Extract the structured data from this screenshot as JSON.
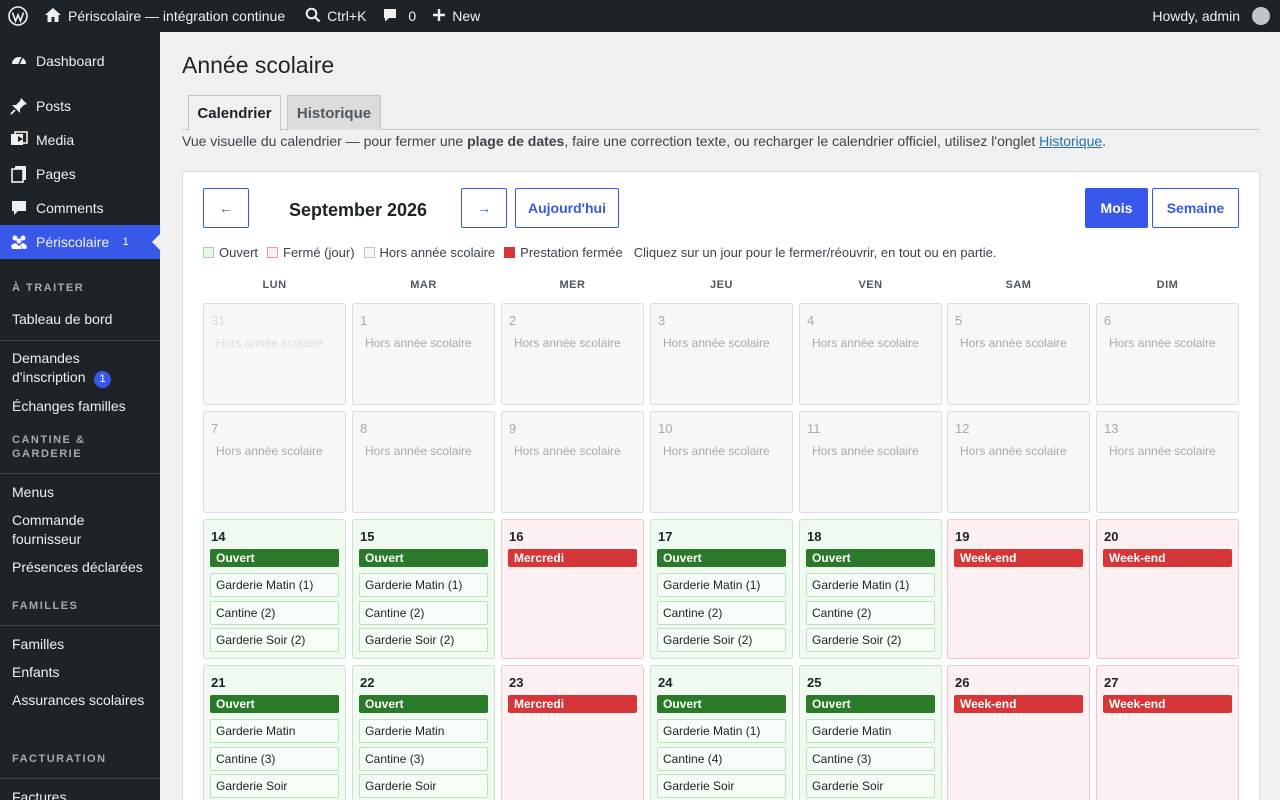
{
  "adminbar": {
    "site_name": "Périscolaire — intégration continue",
    "search_shortcut": "Ctrl+K",
    "comments_count": "0",
    "new_label": "New",
    "howdy": "Howdy, admin"
  },
  "sidebar": {
    "top_items": [
      {
        "label": "Dashboard",
        "icon": "dashboard-icon"
      },
      {
        "label": "Posts",
        "icon": "pin-icon"
      },
      {
        "label": "Media",
        "icon": "media-icon"
      },
      {
        "label": "Pages",
        "icon": "pages-icon"
      },
      {
        "label": "Comments",
        "icon": "comment-icon"
      }
    ],
    "active": {
      "label": "Périscolaire",
      "badge": "1",
      "icon": "group-icon"
    },
    "sections": [
      {
        "heading": "À TRAITER",
        "items": [
          "Tableau de bord"
        ]
      },
      {
        "heading": "",
        "items": [
          "Demandes d'inscription",
          "Échanges familles"
        ],
        "badge": "1"
      },
      {
        "heading": "CANTINE & GARDERIE",
        "items": [
          "Menus",
          "Commande fournisseur",
          "Présences déclarées"
        ]
      },
      {
        "heading": "FAMILLES",
        "items": [
          "Familles",
          "Enfants",
          "Assurances scolaires"
        ]
      },
      {
        "heading": "FACTURATION",
        "items": [
          "Factures"
        ]
      }
    ]
  },
  "page": {
    "title": "Année scolaire",
    "tabs": [
      "Calendrier",
      "Historique"
    ],
    "intro_pre": "Vue visuelle du calendrier — pour fermer une ",
    "intro_bold": "plage de dates",
    "intro_mid": ", faire une correction texte, ou recharger le calendrier officiel, utilisez l'onglet ",
    "intro_link": "Historique",
    "intro_post": "."
  },
  "calendar": {
    "prev": "←",
    "next": "→",
    "month": "September 2026",
    "today": "Aujourd'hui",
    "view_month": "Mois",
    "view_week": "Semaine",
    "legend": [
      {
        "label": "Ouvert",
        "color": "#eaf6ea",
        "border": "#a6d5a6"
      },
      {
        "label": "Fermé (jour)",
        "color": "#fcf0f0",
        "border": "#e89c9c"
      },
      {
        "label": "Hors année scolaire",
        "color": "#f6f7f7",
        "border": "#c3c4c7"
      },
      {
        "label": "Prestation fermée",
        "color": "#d63638",
        "border": "#d63638"
      }
    ],
    "hint": "Cliquez sur un jour pour le fermer/réouvrir, en tout ou en partie.",
    "weekdays": [
      "LUN",
      "MAR",
      "MER",
      "JEU",
      "VEN",
      "SAM",
      "DIM"
    ],
    "weeks": [
      [
        {
          "day": "31",
          "type": "hors",
          "label": "Hors année scolaire",
          "dim": true
        },
        {
          "day": "1",
          "type": "hors",
          "label": "Hors année scolaire"
        },
        {
          "day": "2",
          "type": "hors",
          "label": "Hors année scolaire"
        },
        {
          "day": "3",
          "type": "hors",
          "label": "Hors année scolaire"
        },
        {
          "day": "4",
          "type": "hors",
          "label": "Hors année scolaire"
        },
        {
          "day": "5",
          "type": "hors",
          "label": "Hors année scolaire"
        },
        {
          "day": "6",
          "type": "hors",
          "label": "Hors année scolaire"
        }
      ],
      [
        {
          "day": "7",
          "type": "hors",
          "label": "Hors année scolaire"
        },
        {
          "day": "8",
          "type": "hors",
          "label": "Hors année scolaire"
        },
        {
          "day": "9",
          "type": "hors",
          "label": "Hors année scolaire"
        },
        {
          "day": "10",
          "type": "hors",
          "label": "Hors année scolaire"
        },
        {
          "day": "11",
          "type": "hors",
          "label": "Hors année scolaire"
        },
        {
          "day": "12",
          "type": "hors",
          "label": "Hors année scolaire"
        },
        {
          "day": "13",
          "type": "hors",
          "label": "Hors année scolaire"
        }
      ],
      [
        {
          "day": "14",
          "type": "open",
          "label": "Ouvert",
          "services": [
            "Garderie Matin (1)",
            "Cantine (2)",
            "Garderie Soir (2)"
          ]
        },
        {
          "day": "15",
          "type": "open",
          "label": "Ouvert",
          "services": [
            "Garderie Matin (1)",
            "Cantine (2)",
            "Garderie Soir (2)"
          ]
        },
        {
          "day": "16",
          "type": "closed",
          "label": "Mercredi"
        },
        {
          "day": "17",
          "type": "open",
          "label": "Ouvert",
          "services": [
            "Garderie Matin (1)",
            "Cantine (2)",
            "Garderie Soir (2)"
          ]
        },
        {
          "day": "18",
          "type": "open",
          "label": "Ouvert",
          "services": [
            "Garderie Matin (1)",
            "Cantine (2)",
            "Garderie Soir (2)"
          ]
        },
        {
          "day": "19",
          "type": "closed",
          "label": "Week-end"
        },
        {
          "day": "20",
          "type": "closed",
          "label": "Week-end"
        }
      ],
      [
        {
          "day": "21",
          "type": "open",
          "label": "Ouvert",
          "services": [
            "Garderie Matin",
            "Cantine (3)",
            "Garderie Soir"
          ]
        },
        {
          "day": "22",
          "type": "open",
          "label": "Ouvert",
          "services": [
            "Garderie Matin",
            "Cantine (3)",
            "Garderie Soir"
          ]
        },
        {
          "day": "23",
          "type": "closed",
          "label": "Mercredi"
        },
        {
          "day": "24",
          "type": "open",
          "label": "Ouvert",
          "services": [
            "Garderie Matin (1)",
            "Cantine (4)",
            "Garderie Soir"
          ]
        },
        {
          "day": "25",
          "type": "open",
          "label": "Ouvert",
          "services": [
            "Garderie Matin",
            "Cantine (3)",
            "Garderie Soir"
          ]
        },
        {
          "day": "26",
          "type": "closed",
          "label": "Week-end"
        },
        {
          "day": "27",
          "type": "closed",
          "label": "Week-end"
        }
      ]
    ]
  }
}
